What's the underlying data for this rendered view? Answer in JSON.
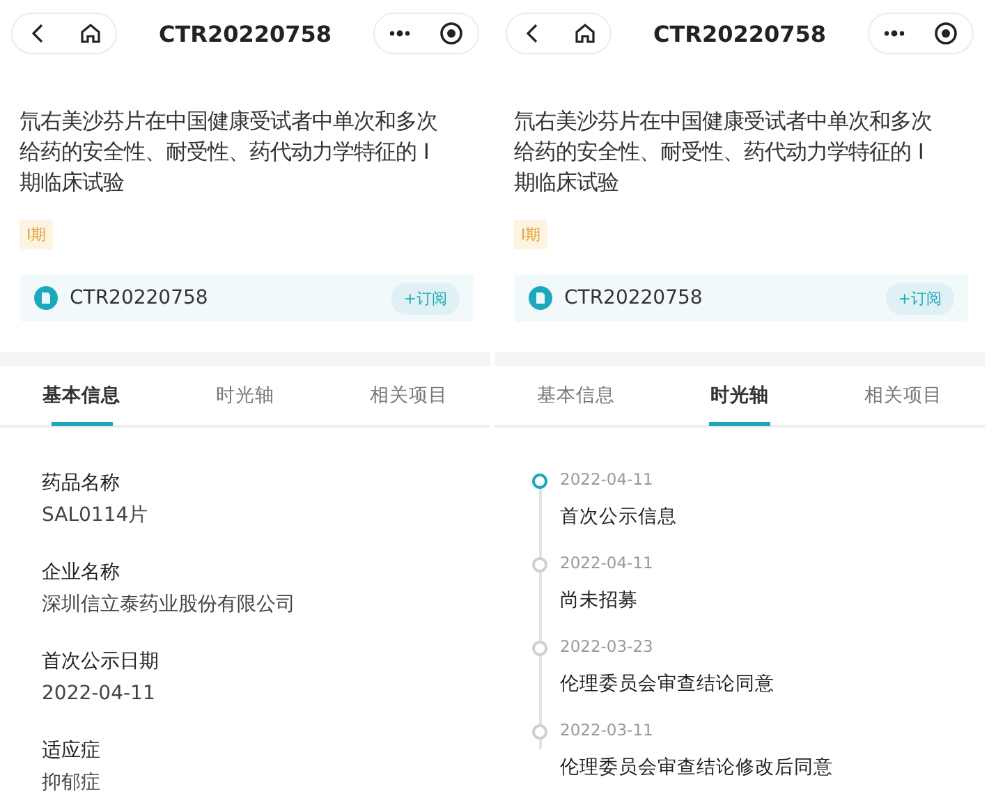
{
  "screens": [
    {
      "kind": "info",
      "nav_title": "CTR20220758",
      "title": "氘右美沙芬片在中国健康受试者中单次和多次给药的安全性、耐受性、药代动力学特征的 I 期临床试验",
      "phase_tag": "I期",
      "registration": {
        "code": "CTR20220758",
        "subscribe": "+订阅"
      },
      "tabs": [
        {
          "label": "基本信息",
          "selected": true
        },
        {
          "label": "时光轴",
          "selected": false
        },
        {
          "label": "相关项目",
          "selected": false
        }
      ],
      "fields": [
        {
          "label": "药品名称",
          "value": "SAL0114片"
        },
        {
          "label": "企业名称",
          "value": "深圳信立泰药业股份有限公司"
        },
        {
          "label": "首次公示日期",
          "value": "2022-04-11"
        },
        {
          "label": "适应症",
          "value": "抑郁症"
        }
      ]
    },
    {
      "kind": "timeline",
      "nav_title": "CTR20220758",
      "title": "氘右美沙芬片在中国健康受试者中单次和多次给药的安全性、耐受性、药代动力学特征的 I 期临床试验",
      "phase_tag": "I期",
      "registration": {
        "code": "CTR20220758",
        "subscribe": "+订阅"
      },
      "tabs": [
        {
          "label": "基本信息",
          "selected": false
        },
        {
          "label": "时光轴",
          "selected": true
        },
        {
          "label": "相关项目",
          "selected": false
        }
      ],
      "events": [
        {
          "date": "2022-04-11",
          "text": "首次公示信息",
          "active": true
        },
        {
          "date": "2022-04-11",
          "text": "尚未招募",
          "active": false
        },
        {
          "date": "2022-03-23",
          "text": "伦理委员会审查结论同意",
          "active": false
        },
        {
          "date": "2022-03-11",
          "text": "伦理委员会审查结论修改后同意",
          "active": false
        }
      ]
    }
  ]
}
